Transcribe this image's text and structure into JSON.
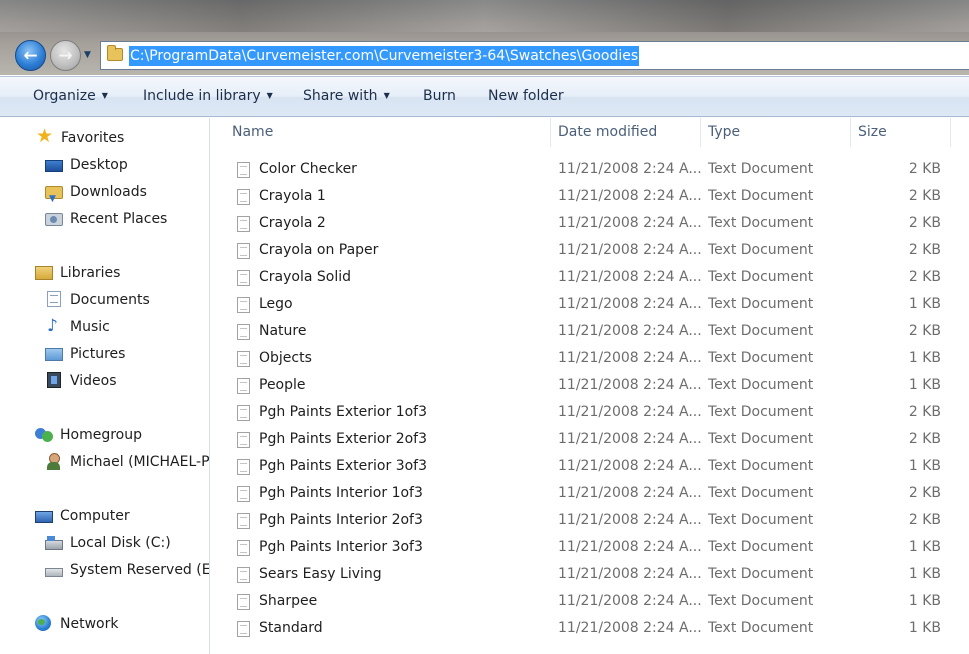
{
  "window": {
    "title_blurred": "",
    "nav": {
      "back_glyph": "←",
      "forward_glyph": "→",
      "history_glyph": "▼"
    },
    "address_path": "C:\\ProgramData\\Curvemeister.com\\Curvemeister3-64\\Swatches\\Goodies"
  },
  "toolbar": {
    "organize": "Organize",
    "include_in_library": "Include in library",
    "share_with": "Share with",
    "burn": "Burn",
    "new_folder": "New folder",
    "caret": "▼"
  },
  "sidebar": {
    "favorites": "Favorites",
    "desktop": "Desktop",
    "downloads": "Downloads",
    "recent_places": "Recent Places",
    "libraries": "Libraries",
    "documents": "Documents",
    "music": "Music",
    "pictures": "Pictures",
    "videos": "Videos",
    "homegroup": "Homegroup",
    "user": "Michael (MICHAEL-P",
    "computer": "Computer",
    "local_disk": "Local Disk (C:)",
    "system_reserved": "System Reserved (E:)",
    "network": "Network"
  },
  "columns": {
    "name": "Name",
    "date_modified": "Date modified",
    "type": "Type",
    "size": "Size",
    "sort_glyph": "^"
  },
  "files": [
    {
      "name": "Color Checker",
      "date": "11/21/2008 2:24 A...",
      "type": "Text Document",
      "size": "2 KB"
    },
    {
      "name": "Crayola 1",
      "date": "11/21/2008 2:24 A...",
      "type": "Text Document",
      "size": "2 KB"
    },
    {
      "name": "Crayola 2",
      "date": "11/21/2008 2:24 A...",
      "type": "Text Document",
      "size": "2 KB"
    },
    {
      "name": "Crayola on Paper",
      "date": "11/21/2008 2:24 A...",
      "type": "Text Document",
      "size": "2 KB"
    },
    {
      "name": "Crayola Solid",
      "date": "11/21/2008 2:24 A...",
      "type": "Text Document",
      "size": "2 KB"
    },
    {
      "name": "Lego",
      "date": "11/21/2008 2:24 A...",
      "type": "Text Document",
      "size": "1 KB"
    },
    {
      "name": "Nature",
      "date": "11/21/2008 2:24 A...",
      "type": "Text Document",
      "size": "2 KB"
    },
    {
      "name": "Objects",
      "date": "11/21/2008 2:24 A...",
      "type": "Text Document",
      "size": "1 KB"
    },
    {
      "name": "People",
      "date": "11/21/2008 2:24 A...",
      "type": "Text Document",
      "size": "1 KB"
    },
    {
      "name": "Pgh Paints Exterior 1of3",
      "date": "11/21/2008 2:24 A...",
      "type": "Text Document",
      "size": "2 KB"
    },
    {
      "name": "Pgh Paints Exterior 2of3",
      "date": "11/21/2008 2:24 A...",
      "type": "Text Document",
      "size": "2 KB"
    },
    {
      "name": "Pgh Paints Exterior 3of3",
      "date": "11/21/2008 2:24 A...",
      "type": "Text Document",
      "size": "1 KB"
    },
    {
      "name": "Pgh Paints Interior 1of3",
      "date": "11/21/2008 2:24 A...",
      "type": "Text Document",
      "size": "2 KB"
    },
    {
      "name": "Pgh Paints Interior 2of3",
      "date": "11/21/2008 2:24 A...",
      "type": "Text Document",
      "size": "2 KB"
    },
    {
      "name": "Pgh Paints Interior 3of3",
      "date": "11/21/2008 2:24 A...",
      "type": "Text Document",
      "size": "1 KB"
    },
    {
      "name": "Sears Easy Living",
      "date": "11/21/2008 2:24 A...",
      "type": "Text Document",
      "size": "1 KB"
    },
    {
      "name": "Sharpee",
      "date": "11/21/2008 2:24 A...",
      "type": "Text Document",
      "size": "1 KB"
    },
    {
      "name": "Standard",
      "date": "11/21/2008 2:24 A...",
      "type": "Text Document",
      "size": "1 KB"
    }
  ],
  "colors": {
    "selection": "#3399ff",
    "toolbar_text": "#1c2f4a",
    "column_header_text": "#4c607a",
    "secondary_text": "#6d6d6d"
  }
}
